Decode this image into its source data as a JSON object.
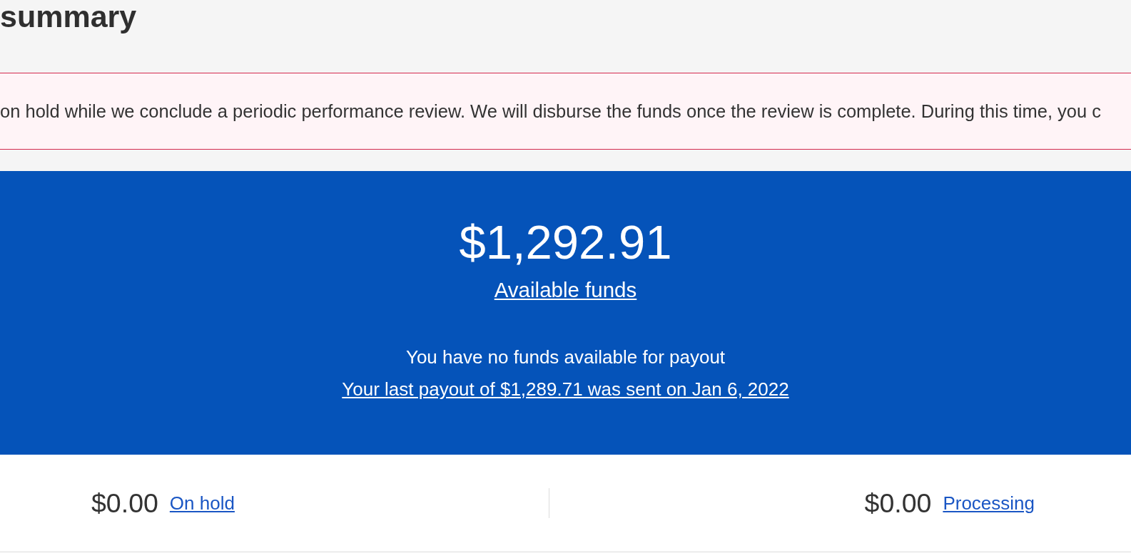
{
  "page": {
    "title": "summary"
  },
  "alert": {
    "text": "on hold while we conclude a periodic performance review. We will disburse the funds once the review is complete. During this time, you c"
  },
  "balance": {
    "amount": "$1,292.91",
    "label": "Available funds",
    "message": "You have no funds available for payout",
    "last_payout": "Your last payout of $1,289.71 was sent on Jan 6, 2022"
  },
  "summary": [
    {
      "amount": "$0.00",
      "label": "On hold"
    },
    {
      "amount": "$0.00",
      "label": "Processing"
    }
  ]
}
